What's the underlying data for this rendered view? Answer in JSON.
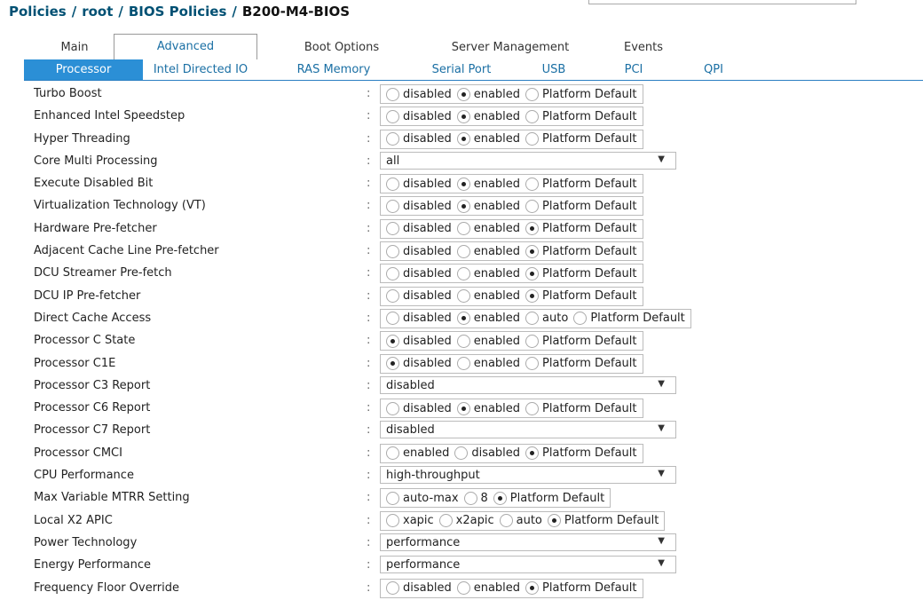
{
  "breadcrumb": [
    "Policies",
    "root",
    "BIOS Policies",
    "B200-M4-BIOS"
  ],
  "tabs": [
    "Main",
    "Advanced",
    "Boot Options",
    "Server Management",
    "Events"
  ],
  "active_tab": "Advanced",
  "subtabs": [
    "Processor",
    "Intel Directed IO",
    "RAS Memory",
    "Serial Port",
    "USB",
    "PCI",
    "QPI"
  ],
  "active_subtab": "Processor",
  "colon": ":",
  "caret": "▼",
  "rows": [
    {
      "label": "Turbo Boost",
      "type": "radio",
      "options": [
        "disabled",
        "enabled",
        "Platform Default"
      ],
      "selected": 1
    },
    {
      "label": "Enhanced Intel Speedstep",
      "type": "radio",
      "options": [
        "disabled",
        "enabled",
        "Platform Default"
      ],
      "selected": 1
    },
    {
      "label": "Hyper Threading",
      "type": "radio",
      "options": [
        "disabled",
        "enabled",
        "Platform Default"
      ],
      "selected": 1
    },
    {
      "label": "Core Multi Processing",
      "type": "select",
      "value": "all"
    },
    {
      "label": "Execute Disabled Bit",
      "type": "radio",
      "options": [
        "disabled",
        "enabled",
        "Platform Default"
      ],
      "selected": 1
    },
    {
      "label": "Virtualization Technology (VT)",
      "type": "radio",
      "options": [
        "disabled",
        "enabled",
        "Platform Default"
      ],
      "selected": 1
    },
    {
      "label": "Hardware Pre-fetcher",
      "type": "radio",
      "options": [
        "disabled",
        "enabled",
        "Platform Default"
      ],
      "selected": 2
    },
    {
      "label": "Adjacent Cache Line Pre-fetcher",
      "type": "radio",
      "options": [
        "disabled",
        "enabled",
        "Platform Default"
      ],
      "selected": 2
    },
    {
      "label": "DCU Streamer Pre-fetch",
      "type": "radio",
      "options": [
        "disabled",
        "enabled",
        "Platform Default"
      ],
      "selected": 2
    },
    {
      "label": "DCU IP Pre-fetcher",
      "type": "radio",
      "options": [
        "disabled",
        "enabled",
        "Platform Default"
      ],
      "selected": 2
    },
    {
      "label": "Direct Cache Access",
      "type": "radio",
      "options": [
        "disabled",
        "enabled",
        "auto",
        "Platform Default"
      ],
      "selected": 1
    },
    {
      "label": "Processor C State",
      "type": "radio",
      "options": [
        "disabled",
        "enabled",
        "Platform Default"
      ],
      "selected": 0
    },
    {
      "label": "Processor C1E",
      "type": "radio",
      "options": [
        "disabled",
        "enabled",
        "Platform Default"
      ],
      "selected": 0
    },
    {
      "label": "Processor C3 Report",
      "type": "select",
      "value": "disabled"
    },
    {
      "label": "Processor C6 Report",
      "type": "radio",
      "options": [
        "disabled",
        "enabled",
        "Platform Default"
      ],
      "selected": 1
    },
    {
      "label": "Processor C7 Report",
      "type": "select",
      "value": "disabled"
    },
    {
      "label": "Processor CMCI",
      "type": "radio",
      "options": [
        "enabled",
        "disabled",
        "Platform Default"
      ],
      "selected": 2
    },
    {
      "label": "CPU Performance",
      "type": "select",
      "value": "high-throughput"
    },
    {
      "label": "Max Variable MTRR Setting",
      "type": "radio",
      "options": [
        "auto-max",
        "8",
        "Platform Default"
      ],
      "selected": 2
    },
    {
      "label": "Local X2 APIC",
      "type": "radio",
      "options": [
        "xapic",
        "x2apic",
        "auto",
        "Platform Default"
      ],
      "selected": 3
    },
    {
      "label": "Power Technology",
      "type": "select",
      "value": "performance"
    },
    {
      "label": "Energy Performance",
      "type": "select",
      "value": "performance"
    },
    {
      "label": "Frequency Floor Override",
      "type": "radio",
      "options": [
        "disabled",
        "enabled",
        "Platform Default"
      ],
      "selected": 2
    }
  ]
}
